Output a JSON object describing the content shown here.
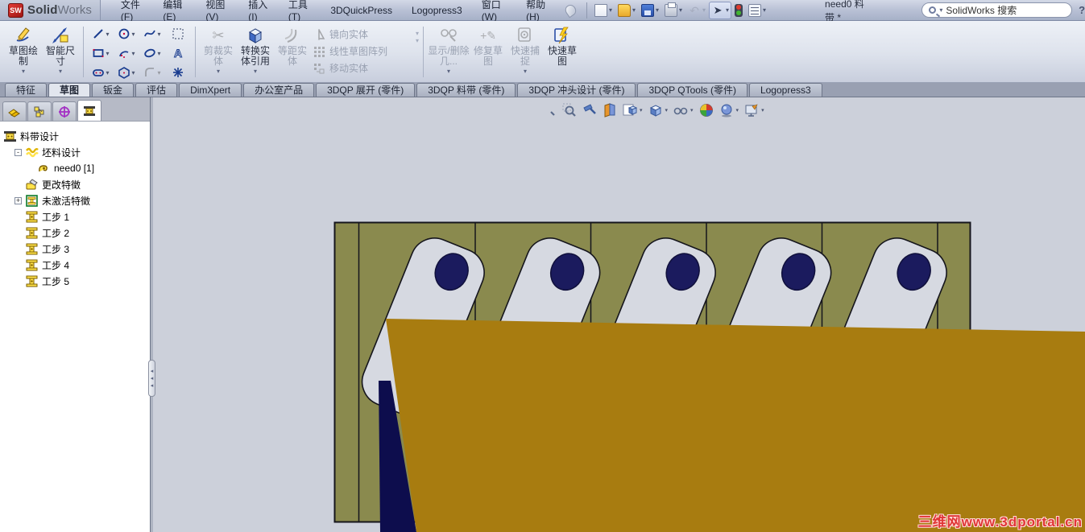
{
  "titlebar": {
    "brand": {
      "cube": "SW",
      "bold": "Solid",
      "light": "Works"
    },
    "menus": [
      "文件(F)",
      "编辑(E)",
      "视图(V)",
      "插入(I)",
      "工具(T)",
      "3DQuickPress",
      "Logopress3",
      "窗口(W)",
      "帮助(H)"
    ],
    "doc_title": "need0 料带 *",
    "search_placeholder": "SolidWorks 搜索",
    "help": "?"
  },
  "glyphs": {
    "caret": "▾",
    "expander_open": "-",
    "expander_closed": "+",
    "splitter_arrow": "◂",
    "undo": "↶",
    "cursor": "➤",
    "scissors": "✂",
    "text_tool": "A",
    "asterisk": "✳",
    "spline": "~",
    "repair": "+✎"
  },
  "ribbon": {
    "sketch": "草图绘制",
    "smart_dimension": "智能尺寸",
    "trim": "剪裁实体",
    "convert": "转换实体引用",
    "offset": "等距实体",
    "mirror": "镜向实体",
    "linear_pattern": "线性草图阵列",
    "move": "移动实体",
    "display_delete": "显示/删除几...",
    "repair_sketch": "修复草图",
    "quick_snaps": "快速捕捉",
    "rapid_sketch": "快速草图"
  },
  "command_tabs": [
    "特征",
    "草图",
    "钣金",
    "评估",
    "DimXpert",
    "办公室产品",
    "3DQP 展开 (零件)",
    "3DQP 料带 (零件)",
    "3DQP 冲头设计 (零件)",
    "3DQP QTools (零件)",
    "Logopress3"
  ],
  "tree": {
    "items": [
      {
        "label": "料带设计"
      },
      {
        "label": "坯料设计"
      },
      {
        "label": "need0 [1]"
      },
      {
        "label": "更改特徵"
      },
      {
        "label": "未激活特徵"
      },
      {
        "label": "工步 1"
      },
      {
        "label": "工步 2"
      },
      {
        "label": "工步 3"
      },
      {
        "label": "工步 4"
      },
      {
        "label": "工步 5"
      }
    ]
  },
  "viewport": {
    "watermark": "三维网www.3dportal.cn"
  },
  "colors": {
    "strip": "#8a8a4e",
    "blank": "#d6d9e1",
    "hole": "#1b1b5e",
    "upper_die": "#a87c10",
    "punch": "#0d0d4d",
    "viewport_bg": "#ccd0da"
  }
}
